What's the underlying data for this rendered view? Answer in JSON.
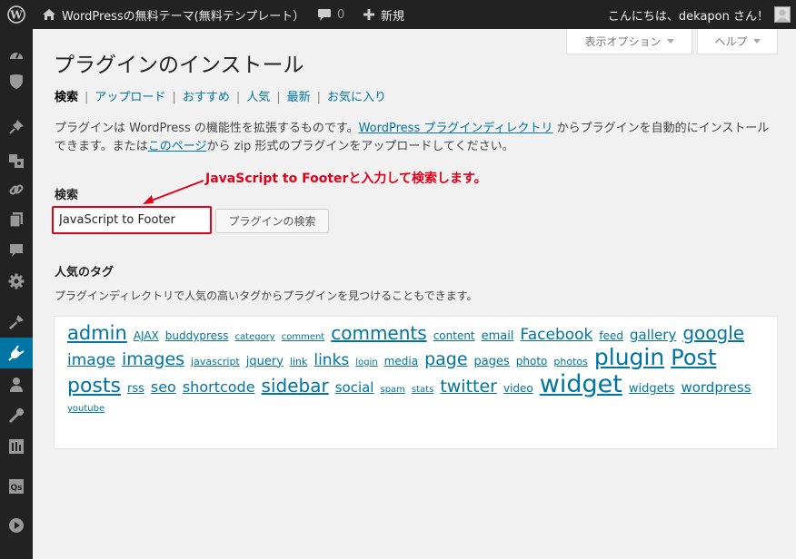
{
  "admin_bar": {
    "site_name": "WordPressの無料テーマ(無料テンプレート）",
    "comment_count": "0",
    "new_label": "新規",
    "greeting": "こんにちは、dekapon さん！"
  },
  "screen_tabs": {
    "screen_options": "表示オプション",
    "help": "ヘルプ"
  },
  "page": {
    "title": "プラグインのインストール",
    "tabs": [
      "検索",
      "アップロード",
      "おすすめ",
      "人気",
      "最新",
      "お気に入り"
    ],
    "intro_before_link1": "プラグインは WordPress の機能性を拡張するものです。",
    "intro_link1": "WordPress プラグインディレクトリ",
    "intro_middle": " からプラグインを自動的にインストールできます。または",
    "intro_link2": "このページ",
    "intro_after": "から zip 形式のプラグインをアップロードしてください。"
  },
  "search": {
    "label": "検索",
    "value": "JavaScript to Footer",
    "button": "プラグインの検索"
  },
  "annotation": "JavaScript to Footerと入力して検索します。",
  "tags": {
    "heading": "人気のタグ",
    "description": "プラグインディレクトリで人気の高いタグからプラグインを見つけることもできます。",
    "items": [
      {
        "name": "admin",
        "size": 21
      },
      {
        "name": "AJAX",
        "size": 12
      },
      {
        "name": "buddypress",
        "size": 12
      },
      {
        "name": "category",
        "size": 10
      },
      {
        "name": "comment",
        "size": 10
      },
      {
        "name": "comments",
        "size": 20
      },
      {
        "name": "content",
        "size": 12
      },
      {
        "name": "email",
        "size": 13
      },
      {
        "name": "Facebook",
        "size": 17
      },
      {
        "name": "feed",
        "size": 12
      },
      {
        "name": "gallery",
        "size": 15
      },
      {
        "name": "google",
        "size": 20
      },
      {
        "name": "image",
        "size": 17
      },
      {
        "name": "images",
        "size": 19
      },
      {
        "name": "javascript",
        "size": 11
      },
      {
        "name": "jquery",
        "size": 13
      },
      {
        "name": "link",
        "size": 11
      },
      {
        "name": "links",
        "size": 17
      },
      {
        "name": "login",
        "size": 10
      },
      {
        "name": "media",
        "size": 12
      },
      {
        "name": "page",
        "size": 19
      },
      {
        "name": "pages",
        "size": 13
      },
      {
        "name": "photo",
        "size": 12
      },
      {
        "name": "photos",
        "size": 11
      },
      {
        "name": "plugin",
        "size": 25
      },
      {
        "name": "Post",
        "size": 24
      },
      {
        "name": "posts",
        "size": 22
      },
      {
        "name": "rss",
        "size": 13
      },
      {
        "name": "seo",
        "size": 16
      },
      {
        "name": "shortcode",
        "size": 16
      },
      {
        "name": "sidebar",
        "size": 20
      },
      {
        "name": "social",
        "size": 15
      },
      {
        "name": "spam",
        "size": 10
      },
      {
        "name": "stats",
        "size": 10
      },
      {
        "name": "twitter",
        "size": 19
      },
      {
        "name": "video",
        "size": 12
      },
      {
        "name": "widget",
        "size": 27
      },
      {
        "name": "widgets",
        "size": 13
      },
      {
        "name": "wordpress",
        "size": 15
      },
      {
        "name": "youtube",
        "size": 10
      }
    ]
  },
  "menu_icons": [
    "dashboard-icon",
    "shield-icon",
    "pin-icon",
    "media-icon",
    "link-icon",
    "pages-icon",
    "comments-icon",
    "gear-icon",
    "appearance-icon",
    "plugins-icon",
    "users-icon",
    "tools-icon",
    "settings-icon",
    "plugin-q-icon",
    "play-icon"
  ],
  "colors": {
    "accent": "#0074a2",
    "annotation": "#e0001a",
    "admin_bar": "#222222"
  }
}
